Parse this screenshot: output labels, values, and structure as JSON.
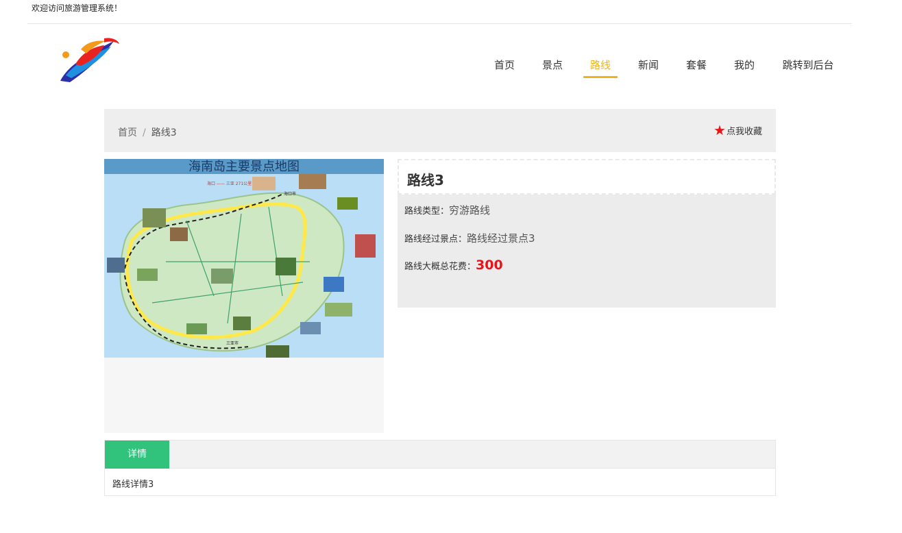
{
  "top": {
    "welcome": "欢迎访问旅游管理系统！"
  },
  "nav": {
    "items": [
      {
        "label": "首页"
      },
      {
        "label": "景点"
      },
      {
        "label": "路线"
      },
      {
        "label": "新闻"
      },
      {
        "label": "套餐"
      },
      {
        "label": "我的"
      },
      {
        "label": "跳转到后台"
      }
    ],
    "active_index": 2,
    "active_color": "#f0b31a"
  },
  "breadcrumb": {
    "home": "首页",
    "separator": "/",
    "current": "路线3"
  },
  "favorite": {
    "label": "点我收藏",
    "icon": "star-icon",
    "color": "#e8141a"
  },
  "map_image": {
    "title": "海南岛主要景点地图",
    "legend": "海口 —— 三亚 271公里",
    "city_top": "海口市",
    "city_bottom": "三亚市"
  },
  "detail": {
    "title": "路线3",
    "type_label": "路线类型：",
    "type_value": "穷游路线",
    "spots_label": "路线经过景点：",
    "spots_value": "路线经过景点3",
    "cost_label": "路线大概总花费：",
    "cost_value": "300"
  },
  "tabs": {
    "active_label": "详情",
    "content": "路线详情3",
    "accent": "#31c27c"
  }
}
